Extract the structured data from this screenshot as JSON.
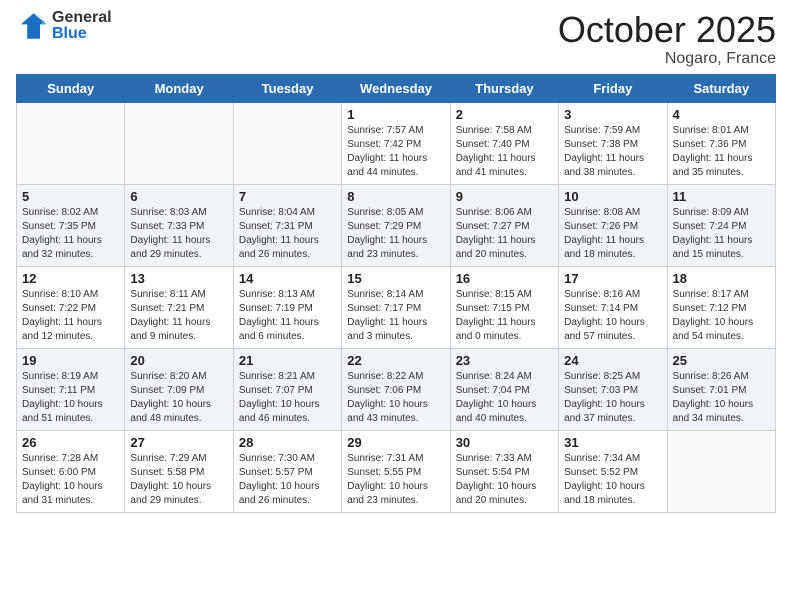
{
  "header": {
    "logo_general": "General",
    "logo_blue": "Blue",
    "month_title": "October 2025",
    "location": "Nogaro, France"
  },
  "weekdays": [
    "Sunday",
    "Monday",
    "Tuesday",
    "Wednesday",
    "Thursday",
    "Friday",
    "Saturday"
  ],
  "weeks": [
    [
      {
        "day": "",
        "info": ""
      },
      {
        "day": "",
        "info": ""
      },
      {
        "day": "",
        "info": ""
      },
      {
        "day": "1",
        "info": "Sunrise: 7:57 AM\nSunset: 7:42 PM\nDaylight: 11 hours and 44 minutes."
      },
      {
        "day": "2",
        "info": "Sunrise: 7:58 AM\nSunset: 7:40 PM\nDaylight: 11 hours and 41 minutes."
      },
      {
        "day": "3",
        "info": "Sunrise: 7:59 AM\nSunset: 7:38 PM\nDaylight: 11 hours and 38 minutes."
      },
      {
        "day": "4",
        "info": "Sunrise: 8:01 AM\nSunset: 7:36 PM\nDaylight: 11 hours and 35 minutes."
      }
    ],
    [
      {
        "day": "5",
        "info": "Sunrise: 8:02 AM\nSunset: 7:35 PM\nDaylight: 11 hours and 32 minutes."
      },
      {
        "day": "6",
        "info": "Sunrise: 8:03 AM\nSunset: 7:33 PM\nDaylight: 11 hours and 29 minutes."
      },
      {
        "day": "7",
        "info": "Sunrise: 8:04 AM\nSunset: 7:31 PM\nDaylight: 11 hours and 26 minutes."
      },
      {
        "day": "8",
        "info": "Sunrise: 8:05 AM\nSunset: 7:29 PM\nDaylight: 11 hours and 23 minutes."
      },
      {
        "day": "9",
        "info": "Sunrise: 8:06 AM\nSunset: 7:27 PM\nDaylight: 11 hours and 20 minutes."
      },
      {
        "day": "10",
        "info": "Sunrise: 8:08 AM\nSunset: 7:26 PM\nDaylight: 11 hours and 18 minutes."
      },
      {
        "day": "11",
        "info": "Sunrise: 8:09 AM\nSunset: 7:24 PM\nDaylight: 11 hours and 15 minutes."
      }
    ],
    [
      {
        "day": "12",
        "info": "Sunrise: 8:10 AM\nSunset: 7:22 PM\nDaylight: 11 hours and 12 minutes."
      },
      {
        "day": "13",
        "info": "Sunrise: 8:11 AM\nSunset: 7:21 PM\nDaylight: 11 hours and 9 minutes."
      },
      {
        "day": "14",
        "info": "Sunrise: 8:13 AM\nSunset: 7:19 PM\nDaylight: 11 hours and 6 minutes."
      },
      {
        "day": "15",
        "info": "Sunrise: 8:14 AM\nSunset: 7:17 PM\nDaylight: 11 hours and 3 minutes."
      },
      {
        "day": "16",
        "info": "Sunrise: 8:15 AM\nSunset: 7:15 PM\nDaylight: 11 hours and 0 minutes."
      },
      {
        "day": "17",
        "info": "Sunrise: 8:16 AM\nSunset: 7:14 PM\nDaylight: 10 hours and 57 minutes."
      },
      {
        "day": "18",
        "info": "Sunrise: 8:17 AM\nSunset: 7:12 PM\nDaylight: 10 hours and 54 minutes."
      }
    ],
    [
      {
        "day": "19",
        "info": "Sunrise: 8:19 AM\nSunset: 7:11 PM\nDaylight: 10 hours and 51 minutes."
      },
      {
        "day": "20",
        "info": "Sunrise: 8:20 AM\nSunset: 7:09 PM\nDaylight: 10 hours and 48 minutes."
      },
      {
        "day": "21",
        "info": "Sunrise: 8:21 AM\nSunset: 7:07 PM\nDaylight: 10 hours and 46 minutes."
      },
      {
        "day": "22",
        "info": "Sunrise: 8:22 AM\nSunset: 7:06 PM\nDaylight: 10 hours and 43 minutes."
      },
      {
        "day": "23",
        "info": "Sunrise: 8:24 AM\nSunset: 7:04 PM\nDaylight: 10 hours and 40 minutes."
      },
      {
        "day": "24",
        "info": "Sunrise: 8:25 AM\nSunset: 7:03 PM\nDaylight: 10 hours and 37 minutes."
      },
      {
        "day": "25",
        "info": "Sunrise: 8:26 AM\nSunset: 7:01 PM\nDaylight: 10 hours and 34 minutes."
      }
    ],
    [
      {
        "day": "26",
        "info": "Sunrise: 7:28 AM\nSunset: 6:00 PM\nDaylight: 10 hours and 31 minutes."
      },
      {
        "day": "27",
        "info": "Sunrise: 7:29 AM\nSunset: 5:58 PM\nDaylight: 10 hours and 29 minutes."
      },
      {
        "day": "28",
        "info": "Sunrise: 7:30 AM\nSunset: 5:57 PM\nDaylight: 10 hours and 26 minutes."
      },
      {
        "day": "29",
        "info": "Sunrise: 7:31 AM\nSunset: 5:55 PM\nDaylight: 10 hours and 23 minutes."
      },
      {
        "day": "30",
        "info": "Sunrise: 7:33 AM\nSunset: 5:54 PM\nDaylight: 10 hours and 20 minutes."
      },
      {
        "day": "31",
        "info": "Sunrise: 7:34 AM\nSunset: 5:52 PM\nDaylight: 10 hours and 18 minutes."
      },
      {
        "day": "",
        "info": ""
      }
    ]
  ]
}
